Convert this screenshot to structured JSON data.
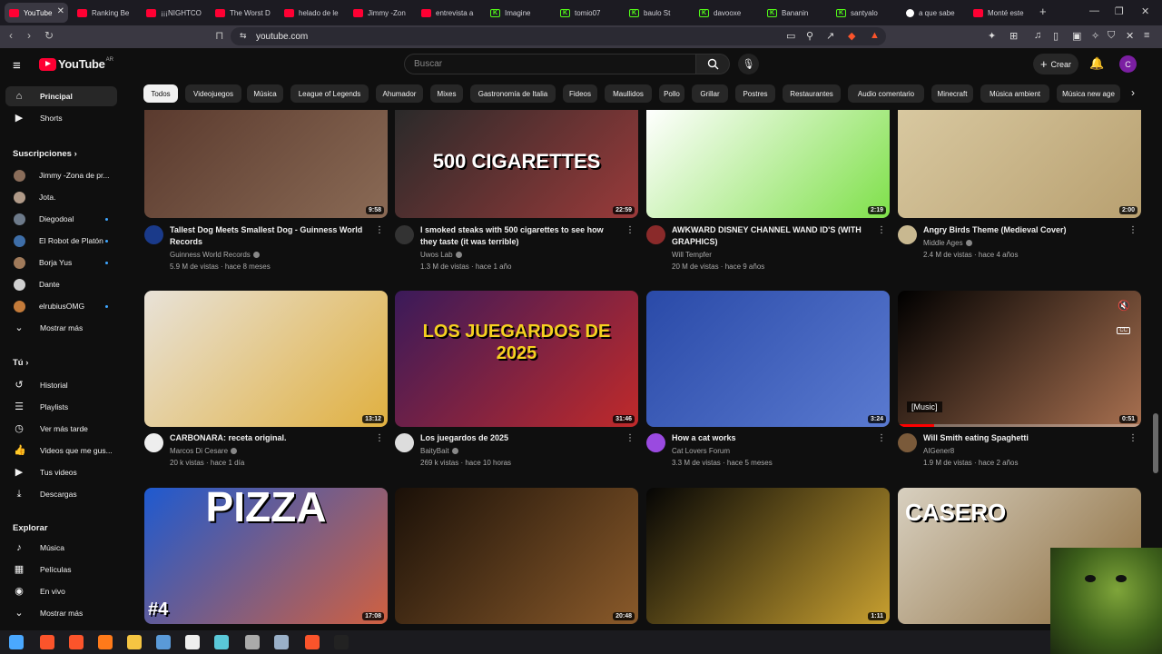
{
  "browser": {
    "tabs": [
      {
        "title": "YouTube",
        "kind": "yt",
        "active": true
      },
      {
        "title": "Ranking Be",
        "kind": "yt"
      },
      {
        "title": "¡¡¡NIGHTCO",
        "kind": "yt"
      },
      {
        "title": "The Worst D",
        "kind": "yt"
      },
      {
        "title": "helado de le",
        "kind": "yt"
      },
      {
        "title": "Jimmy -Zon",
        "kind": "yt"
      },
      {
        "title": "entrevista a",
        "kind": "yt"
      },
      {
        "title": "Imagine",
        "kind": "kick"
      },
      {
        "title": "tomio07",
        "kind": "kick"
      },
      {
        "title": "baulo St",
        "kind": "kick"
      },
      {
        "title": "davooxe",
        "kind": "kick"
      },
      {
        "title": "Bananin",
        "kind": "kick"
      },
      {
        "title": "santyalo",
        "kind": "kick"
      },
      {
        "title": "a que sabe",
        "kind": "g"
      },
      {
        "title": "Monté este",
        "kind": "yt"
      }
    ],
    "url": "youtube.com"
  },
  "header": {
    "logo_text": "YouTube",
    "country": "AR",
    "search_placeholder": "Buscar",
    "create_label": "Crear",
    "avatar_letter": "C"
  },
  "sidebar": {
    "main": [
      {
        "label": "Principal",
        "icon": "home-icon",
        "active": true
      },
      {
        "label": "Shorts",
        "icon": "shorts-icon"
      }
    ],
    "subs_title": "Suscripciones",
    "subs": [
      {
        "label": "Jimmy -Zona de pr...",
        "color": "#8a6d5a",
        "dot": false
      },
      {
        "label": "Jota.",
        "color": "#b09a88",
        "dot": false
      },
      {
        "label": "Diegodoal",
        "color": "#6d7a8a",
        "dot": true
      },
      {
        "label": "El Robot de Platón",
        "color": "#3e6ea8",
        "dot": true
      },
      {
        "label": "Borja Yus",
        "color": "#a07a5a",
        "dot": true
      },
      {
        "label": "Dante",
        "color": "#d0d0d0",
        "dot": false
      },
      {
        "label": "elrubiusOMG",
        "color": "#c47b3a",
        "dot": true
      }
    ],
    "more_label": "Mostrar más",
    "you_title": "Tú",
    "you": [
      {
        "label": "Historial",
        "icon": "history-icon"
      },
      {
        "label": "Playlists",
        "icon": "playlists-icon"
      },
      {
        "label": "Ver más tarde",
        "icon": "watch-later-icon"
      },
      {
        "label": "Videos que me gus...",
        "icon": "like-icon"
      },
      {
        "label": "Tus videos",
        "icon": "your-videos-icon"
      },
      {
        "label": "Descargas",
        "icon": "downloads-icon"
      }
    ],
    "explore_title": "Explorar",
    "explore": [
      {
        "label": "Música",
        "icon": "music-icon"
      },
      {
        "label": "Películas",
        "icon": "movies-icon"
      },
      {
        "label": "En vivo",
        "icon": "live-icon"
      }
    ],
    "more_label_2": "Mostrar más"
  },
  "chips": [
    "Todos",
    "Videojuegos",
    "Música",
    "League of Legends",
    "Ahumador",
    "Mixes",
    "Gastronomía de Italia",
    "Fideos",
    "Maullidos",
    "Pollo",
    "Grillar",
    "Postres",
    "Restaurantes",
    "Audio comentario",
    "Minecraft",
    "Música ambient",
    "Música new age"
  ],
  "videos": [
    {
      "title": "Tallest Dog Meets Smallest Dog - Guinness World Records",
      "channel": "Guinness World Records",
      "verified": true,
      "meta": "5.9 M de vistas · hace 8 meses",
      "duration": "9:58",
      "thumb": [
        "#5a3a2e",
        "#8a6a55"
      ],
      "avatar": "#1a3a8a"
    },
    {
      "title": "I smoked steaks with 500 cigarettes to see how they taste (it was terrible)",
      "channel": "Uwos Lab",
      "verified": true,
      "meta": "1.3 M de vistas · hace 1 año",
      "duration": "22:59",
      "thumb": [
        "#2a2a2a",
        "#9a3a3a"
      ],
      "avatar": "#333333",
      "overlay": "500 CIGARETTES"
    },
    {
      "title": "AWKWARD DISNEY CHANNEL WAND ID'S (WITH GRAPHICS)",
      "channel": "Will Tempfer",
      "verified": false,
      "meta": "20 M de vistas · hace 9 años",
      "duration": "2:19",
      "thumb": [
        "#ffffff",
        "#7fe04a"
      ],
      "avatar": "#8a2a2a"
    },
    {
      "title": "Angry Birds Theme (Medieval Cover)",
      "channel": "Middle Ages",
      "verified": true,
      "meta": "2.4 M de vistas · hace 4 años",
      "duration": "2:00",
      "thumb": [
        "#d8c8a0",
        "#b8a070"
      ],
      "avatar": "#c8b890"
    },
    {
      "title": "CARBONARA: receta original.",
      "channel": "Marcos Di Cesare",
      "verified": true,
      "meta": "20 k vistas · hace 1 día",
      "duration": "13:12",
      "thumb": [
        "#e8e2d8",
        "#e0b040"
      ],
      "avatar": "#eeeeee"
    },
    {
      "title": "Los juegardos de 2025",
      "channel": "BaityBait",
      "verified": true,
      "meta": "269 k vistas · hace 10 horas",
      "duration": "31:46",
      "thumb": [
        "#3a1a5a",
        "#c02a2a"
      ],
      "avatar": "#dddddd",
      "overlay": "LOS JUEGARDOS DE 2025"
    },
    {
      "title": "How a cat works",
      "channel": "Cat Lovers Forum",
      "verified": false,
      "meta": "3.3 M de vistas · hace 5 meses",
      "duration": "3:24",
      "thumb": [
        "#2a4aa8",
        "#5a7ad0"
      ],
      "avatar": "#9a4ae0"
    },
    {
      "title": "Will Smith eating Spaghetti",
      "channel": "AIGener8",
      "verified": false,
      "meta": "1.9 M de vistas · hace 2 años",
      "duration": "0:51",
      "thumb": [
        "#000000",
        "#a87050"
      ],
      "avatar": "#7a5a3a",
      "caption": "[Music]"
    },
    {
      "title": "",
      "channel": "",
      "verified": false,
      "meta": "",
      "duration": "17:08",
      "thumb": [
        "#1e5ad0",
        "#d06040"
      ],
      "avatar": "",
      "overlay": "PIZZA",
      "badge": "#4"
    },
    {
      "title": "",
      "channel": "",
      "verified": false,
      "meta": "",
      "duration": "20:48",
      "thumb": [
        "#1a1008",
        "#8a5a2a"
      ],
      "avatar": ""
    },
    {
      "title": "",
      "channel": "",
      "verified": false,
      "meta": "",
      "duration": "1:11",
      "thumb": [
        "#050505",
        "#c8a030"
      ],
      "avatar": ""
    },
    {
      "title": "",
      "channel": "",
      "verified": false,
      "meta": "",
      "duration": "",
      "thumb": [
        "#d8d0c0",
        "#8a6a3a"
      ],
      "avatar": "",
      "overlay": "CASERO"
    }
  ],
  "player": {
    "mute_icon": "mute-icon",
    "cc_label": "CC",
    "caption": "[Music]"
  }
}
